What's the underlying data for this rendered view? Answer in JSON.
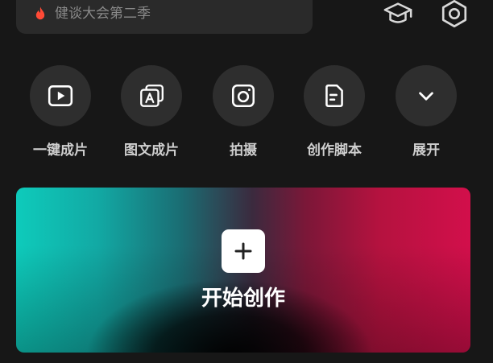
{
  "search": {
    "text": "健谈大会第二季",
    "icon": "flame-icon"
  },
  "header_icons": {
    "learn": "graduation-cap-icon",
    "settings": "settings-icon"
  },
  "quick_actions": [
    {
      "label": "一键成片",
      "icon": "play-video-icon"
    },
    {
      "label": "图文成片",
      "icon": "image-text-icon"
    },
    {
      "label": "拍摄",
      "icon": "camera-icon"
    },
    {
      "label": "创作脚本",
      "icon": "script-icon"
    },
    {
      "label": "展开",
      "icon": "chevron-down-icon"
    }
  ],
  "create_card": {
    "label": "开始创作",
    "icon": "plus-icon"
  },
  "colors": {
    "background": "#171717",
    "surface": "#2e2e2e",
    "gradient_left": "#0ecbbb",
    "gradient_right": "#d20f4b",
    "flame": "#ff4a36"
  }
}
